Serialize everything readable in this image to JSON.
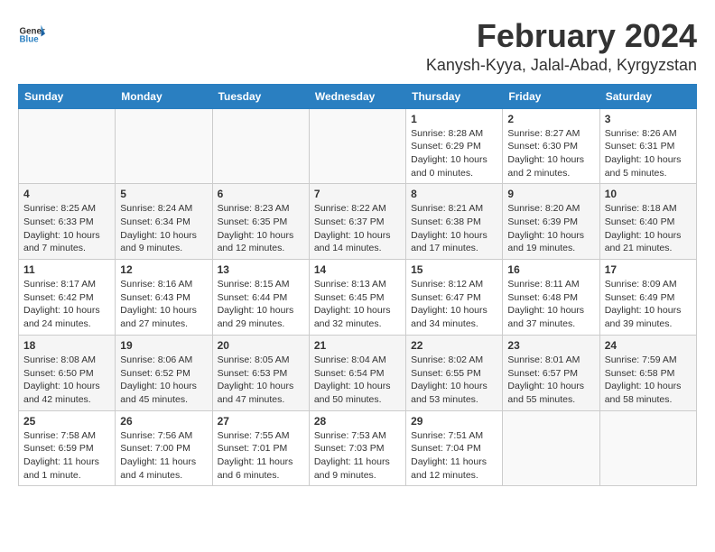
{
  "header": {
    "logo_general": "General",
    "logo_blue": "Blue",
    "month_title": "February 2024",
    "location": "Kanysh-Kyya, Jalal-Abad, Kyrgyzstan"
  },
  "weekdays": [
    "Sunday",
    "Monday",
    "Tuesday",
    "Wednesday",
    "Thursday",
    "Friday",
    "Saturday"
  ],
  "weeks": [
    [
      {
        "day": "",
        "info": ""
      },
      {
        "day": "",
        "info": ""
      },
      {
        "day": "",
        "info": ""
      },
      {
        "day": "",
        "info": ""
      },
      {
        "day": "1",
        "info": "Sunrise: 8:28 AM\nSunset: 6:29 PM\nDaylight: 10 hours and 0 minutes."
      },
      {
        "day": "2",
        "info": "Sunrise: 8:27 AM\nSunset: 6:30 PM\nDaylight: 10 hours and 2 minutes."
      },
      {
        "day": "3",
        "info": "Sunrise: 8:26 AM\nSunset: 6:31 PM\nDaylight: 10 hours and 5 minutes."
      }
    ],
    [
      {
        "day": "4",
        "info": "Sunrise: 8:25 AM\nSunset: 6:33 PM\nDaylight: 10 hours and 7 minutes."
      },
      {
        "day": "5",
        "info": "Sunrise: 8:24 AM\nSunset: 6:34 PM\nDaylight: 10 hours and 9 minutes."
      },
      {
        "day": "6",
        "info": "Sunrise: 8:23 AM\nSunset: 6:35 PM\nDaylight: 10 hours and 12 minutes."
      },
      {
        "day": "7",
        "info": "Sunrise: 8:22 AM\nSunset: 6:37 PM\nDaylight: 10 hours and 14 minutes."
      },
      {
        "day": "8",
        "info": "Sunrise: 8:21 AM\nSunset: 6:38 PM\nDaylight: 10 hours and 17 minutes."
      },
      {
        "day": "9",
        "info": "Sunrise: 8:20 AM\nSunset: 6:39 PM\nDaylight: 10 hours and 19 minutes."
      },
      {
        "day": "10",
        "info": "Sunrise: 8:18 AM\nSunset: 6:40 PM\nDaylight: 10 hours and 21 minutes."
      }
    ],
    [
      {
        "day": "11",
        "info": "Sunrise: 8:17 AM\nSunset: 6:42 PM\nDaylight: 10 hours and 24 minutes."
      },
      {
        "day": "12",
        "info": "Sunrise: 8:16 AM\nSunset: 6:43 PM\nDaylight: 10 hours and 27 minutes."
      },
      {
        "day": "13",
        "info": "Sunrise: 8:15 AM\nSunset: 6:44 PM\nDaylight: 10 hours and 29 minutes."
      },
      {
        "day": "14",
        "info": "Sunrise: 8:13 AM\nSunset: 6:45 PM\nDaylight: 10 hours and 32 minutes."
      },
      {
        "day": "15",
        "info": "Sunrise: 8:12 AM\nSunset: 6:47 PM\nDaylight: 10 hours and 34 minutes."
      },
      {
        "day": "16",
        "info": "Sunrise: 8:11 AM\nSunset: 6:48 PM\nDaylight: 10 hours and 37 minutes."
      },
      {
        "day": "17",
        "info": "Sunrise: 8:09 AM\nSunset: 6:49 PM\nDaylight: 10 hours and 39 minutes."
      }
    ],
    [
      {
        "day": "18",
        "info": "Sunrise: 8:08 AM\nSunset: 6:50 PM\nDaylight: 10 hours and 42 minutes."
      },
      {
        "day": "19",
        "info": "Sunrise: 8:06 AM\nSunset: 6:52 PM\nDaylight: 10 hours and 45 minutes."
      },
      {
        "day": "20",
        "info": "Sunrise: 8:05 AM\nSunset: 6:53 PM\nDaylight: 10 hours and 47 minutes."
      },
      {
        "day": "21",
        "info": "Sunrise: 8:04 AM\nSunset: 6:54 PM\nDaylight: 10 hours and 50 minutes."
      },
      {
        "day": "22",
        "info": "Sunrise: 8:02 AM\nSunset: 6:55 PM\nDaylight: 10 hours and 53 minutes."
      },
      {
        "day": "23",
        "info": "Sunrise: 8:01 AM\nSunset: 6:57 PM\nDaylight: 10 hours and 55 minutes."
      },
      {
        "day": "24",
        "info": "Sunrise: 7:59 AM\nSunset: 6:58 PM\nDaylight: 10 hours and 58 minutes."
      }
    ],
    [
      {
        "day": "25",
        "info": "Sunrise: 7:58 AM\nSunset: 6:59 PM\nDaylight: 11 hours and 1 minute."
      },
      {
        "day": "26",
        "info": "Sunrise: 7:56 AM\nSunset: 7:00 PM\nDaylight: 11 hours and 4 minutes."
      },
      {
        "day": "27",
        "info": "Sunrise: 7:55 AM\nSunset: 7:01 PM\nDaylight: 11 hours and 6 minutes."
      },
      {
        "day": "28",
        "info": "Sunrise: 7:53 AM\nSunset: 7:03 PM\nDaylight: 11 hours and 9 minutes."
      },
      {
        "day": "29",
        "info": "Sunrise: 7:51 AM\nSunset: 7:04 PM\nDaylight: 11 hours and 12 minutes."
      },
      {
        "day": "",
        "info": ""
      },
      {
        "day": "",
        "info": ""
      }
    ]
  ]
}
